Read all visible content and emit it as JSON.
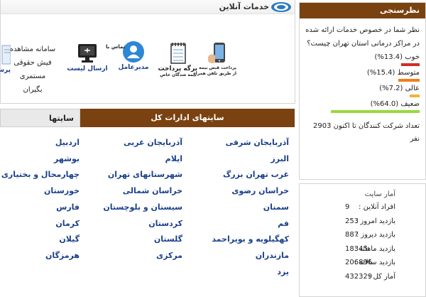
{
  "services": {
    "title": "خدمات آنلاین",
    "items": [
      {
        "label": "پرداخت قبض بیمه",
        "sub": "از طریق تلفن همراه"
      },
      {
        "label": "برگه پرداخت",
        "sub": "بیمه شدگان خاص"
      },
      {
        "label": "مدیرعامل",
        "sub": "تماس با"
      },
      {
        "label": "ارسال لیست",
        "sub": ""
      },
      {
        "label": "پرس",
        "sub": ""
      }
    ],
    "text_links": [
      "سامانه مشاهده",
      "فیش حقوقی",
      "مستمری",
      "بگیران"
    ]
  },
  "poll": {
    "title": "نظرسنجی",
    "question": "نظر شما در خصوص خدمات ارائه شده در مراکز درمانی استان تهران چیست؟",
    "options": [
      {
        "label": "خوب (13.4%)",
        "percent": 13.4,
        "color": "#d62b22"
      },
      {
        "label": "متوسط (15.4%)",
        "percent": 15.4,
        "color": "#ef7f1a"
      },
      {
        "label": "عالی (7.2%)",
        "percent": 7.2,
        "color": "#f2b33a"
      },
      {
        "label": "ضعیف (64.0%)",
        "percent": 64.0,
        "color": "#9bd93c"
      }
    ],
    "total_text": "تعداد شرکت کنندگان تا اکنون 2903 نفر"
  },
  "stats": {
    "title": "آمار سایت",
    "rows": [
      {
        "label": "افراد آنلاین :",
        "value": "9"
      },
      {
        "label": "بازدید امروز :",
        "value": "253"
      },
      {
        "label": "بازدید دیروز :",
        "value": "887"
      },
      {
        "label": "بازدید ماهانه :",
        "value": "18345"
      },
      {
        "label": "بازدید سالانه :",
        "value": "206896"
      },
      {
        "label": "آمار کل :",
        "value": "432329"
      }
    ]
  },
  "directorates": {
    "tab_main": "سایتهای ادارات کل",
    "tab_other": "سایتها",
    "col1": [
      "آذربایجان شرقی",
      "البرز",
      "غرب تهران بزرگ",
      "خراسان رضوی",
      "سمنان",
      "قم",
      "کهگیلویه و بویراحمد",
      "مازندران",
      "یزد"
    ],
    "col2": [
      "آذربایجان غربی",
      "ایلام",
      "شهرستانهای تهران",
      "خراسان شمالی",
      "سیستان و بلوچستان",
      "کردستان",
      "گلستان",
      "مرکزی"
    ],
    "col3": [
      "اردبیل",
      "بوشهر",
      "چهارمحال و بختیاری",
      "خوزستان",
      "فارس",
      "کرمان",
      "گیلان",
      "هرمزگان"
    ]
  }
}
